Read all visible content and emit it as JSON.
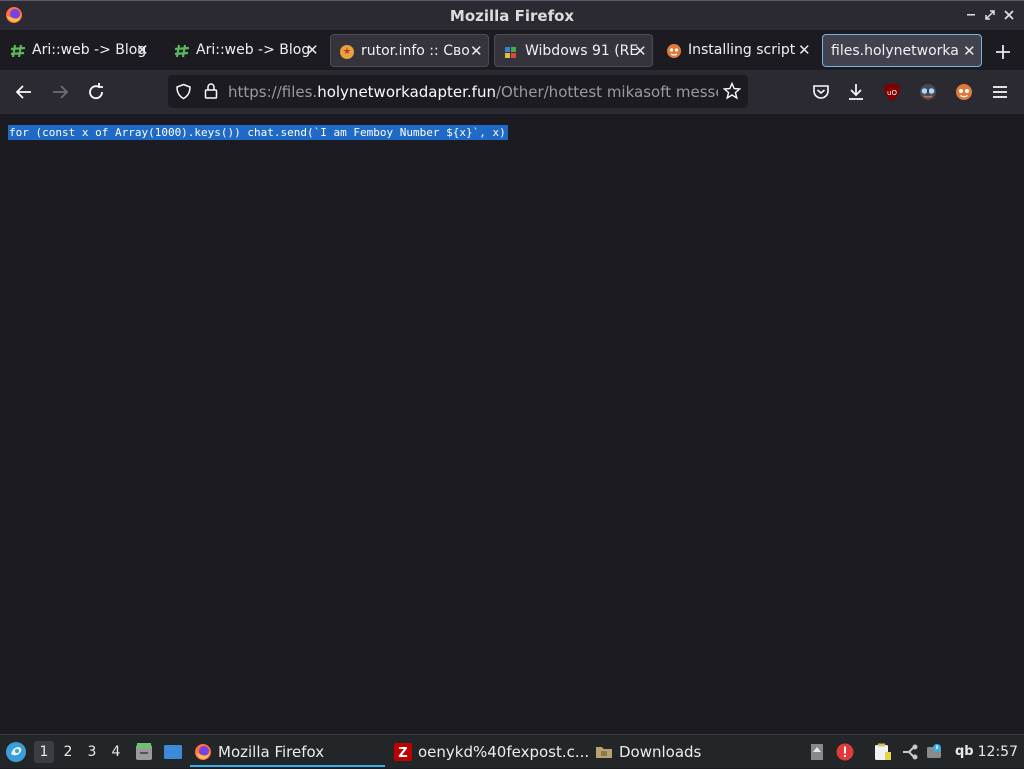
{
  "window": {
    "title": "Mozilla Firefox"
  },
  "tabs": [
    {
      "label": "Ari::web -> Blog",
      "icon": "hash-green-icon",
      "state": "normal"
    },
    {
      "label": "Ari::web -> Blog",
      "icon": "hash-green-icon",
      "state": "normal"
    },
    {
      "label": "rutor.info :: Сво",
      "icon": "rutor-icon",
      "state": "bordered"
    },
    {
      "label": "Wibdows 91 (RE",
      "icon": "wibdows-icon",
      "state": "bordered"
    },
    {
      "label": "Installing script",
      "icon": "tampermonkey-icon",
      "state": "normal"
    },
    {
      "label": "files.holynetworka",
      "icon": "none",
      "state": "active"
    }
  ],
  "toolbar": {
    "url_prefix": "https://files.",
    "url_host": "holynetworkadapter.fun",
    "url_path": "/Other/hottest mikasoft messenge"
  },
  "page": {
    "code_line": "for (const x of Array(1000).keys()) chat.send(`I am Femboy Number ${x}`, x)"
  },
  "taskbar": {
    "workspaces": [
      "1",
      "2",
      "3",
      "4"
    ],
    "current_workspace": "1",
    "tasks": [
      {
        "label": "Mozilla Firefox",
        "icon": "firefox-icon",
        "active": true
      },
      {
        "label": "oenykd%40fexpost.c...",
        "icon": "filezilla-icon",
        "active": false
      },
      {
        "label": "Downloads",
        "icon": "folder-icon",
        "active": false
      }
    ],
    "tray_text_qb": "qb",
    "clock": "12:57"
  },
  "colors": {
    "accent": "#72b6e8",
    "selection": "#1e6ac6",
    "background": "#1c1b22",
    "toolbar": "#2b2a33"
  }
}
